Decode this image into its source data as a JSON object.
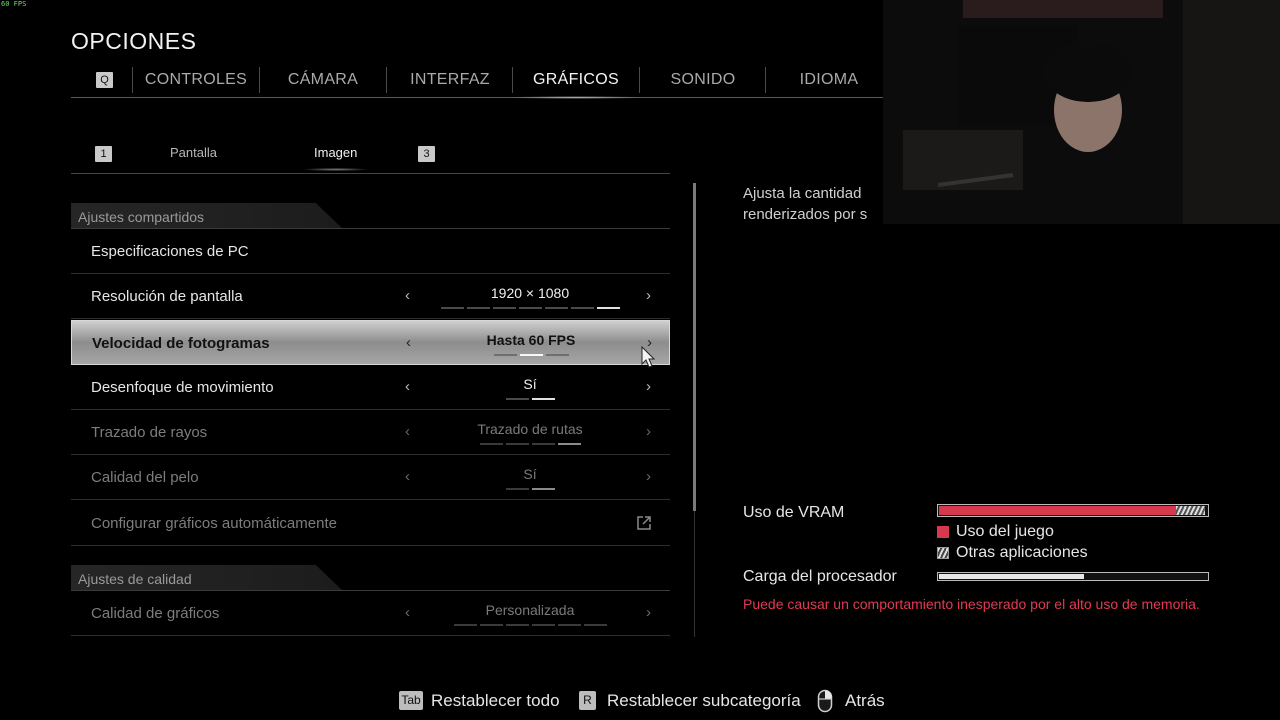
{
  "overlay": {
    "fps": "60 FPS"
  },
  "title": "OPCIONES",
  "top_tabs": {
    "left_key": "Q",
    "items": [
      "CONTROLES",
      "CÁMARA",
      "INTERFAZ",
      "GRÁFICOS",
      "SONIDO",
      "IDIOMA"
    ],
    "active": "GRÁFICOS"
  },
  "sub_tabs": {
    "left_key": "1",
    "right_key": "3",
    "items": [
      "Pantalla",
      "Imagen"
    ],
    "active": "Imagen"
  },
  "sections": {
    "shared": "Ajustes compartidos",
    "quality": "Ajustes de calidad"
  },
  "rows": [
    {
      "label": "Especificaciones de PC"
    },
    {
      "label": "Resolución de pantalla",
      "value": "1920 × 1080",
      "pips": 7,
      "selected": 7
    },
    {
      "label": "Velocidad de fotogramas",
      "value": "Hasta 60 FPS",
      "pips": 3,
      "selected": 2
    },
    {
      "label": "Desenfoque de movimiento",
      "value": "Sí",
      "pips": 2,
      "selected": 2
    },
    {
      "label": "Trazado de rayos",
      "value": "Trazado de rutas",
      "pips": 4,
      "selected": 4
    },
    {
      "label": "Calidad del pelo",
      "value": "Sí",
      "pips": 2,
      "selected": 2
    },
    {
      "label": "Configurar gráficos automáticamente"
    },
    {
      "label": "Calidad de gráficos",
      "value": "Personalizada",
      "pips": 6,
      "selected": 0
    }
  ],
  "description": {
    "line1": "Ajusta la cantidad",
    "line2": "renderizados por s"
  },
  "vram": {
    "label": "Uso de VRAM",
    "game_fraction": 0.885,
    "other_fraction": 0.11,
    "legend_game": "Uso del juego",
    "legend_other": "Otras aplicaciones",
    "game_color": "#d6384e"
  },
  "cpu": {
    "label": "Carga del procesador",
    "fraction": 0.54
  },
  "warning": "Puede causar un comportamiento inesperado por el alto uso de memoria.",
  "footer": {
    "reset_all_key": "Tab",
    "reset_all": "Restablecer todo",
    "reset_sub_key": "R",
    "reset_sub": "Restablecer subcategoría",
    "back": "Atrás"
  }
}
